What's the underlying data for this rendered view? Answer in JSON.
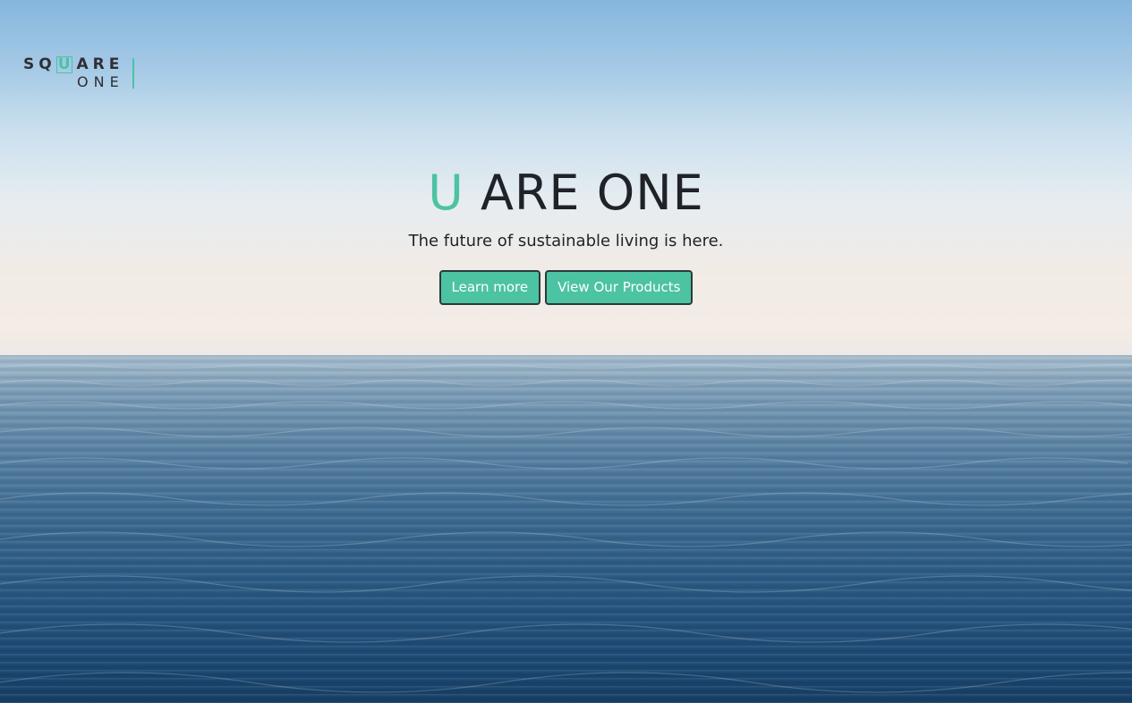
{
  "brand": {
    "logo_top": "SQUARE",
    "logo_highlight": "U",
    "logo_top_left": "SQ",
    "logo_top_right": "ARE",
    "logo_bottom": "ONE",
    "accent_color": "#4cc3a3"
  },
  "hero": {
    "headline_accent": "U",
    "headline_rest": "ARE ONE",
    "tagline": "The future of sustainable living is here.",
    "background": "ocean horizon photo"
  },
  "actions": {
    "learn_more": "Learn more",
    "view_products": "View Our Products"
  }
}
